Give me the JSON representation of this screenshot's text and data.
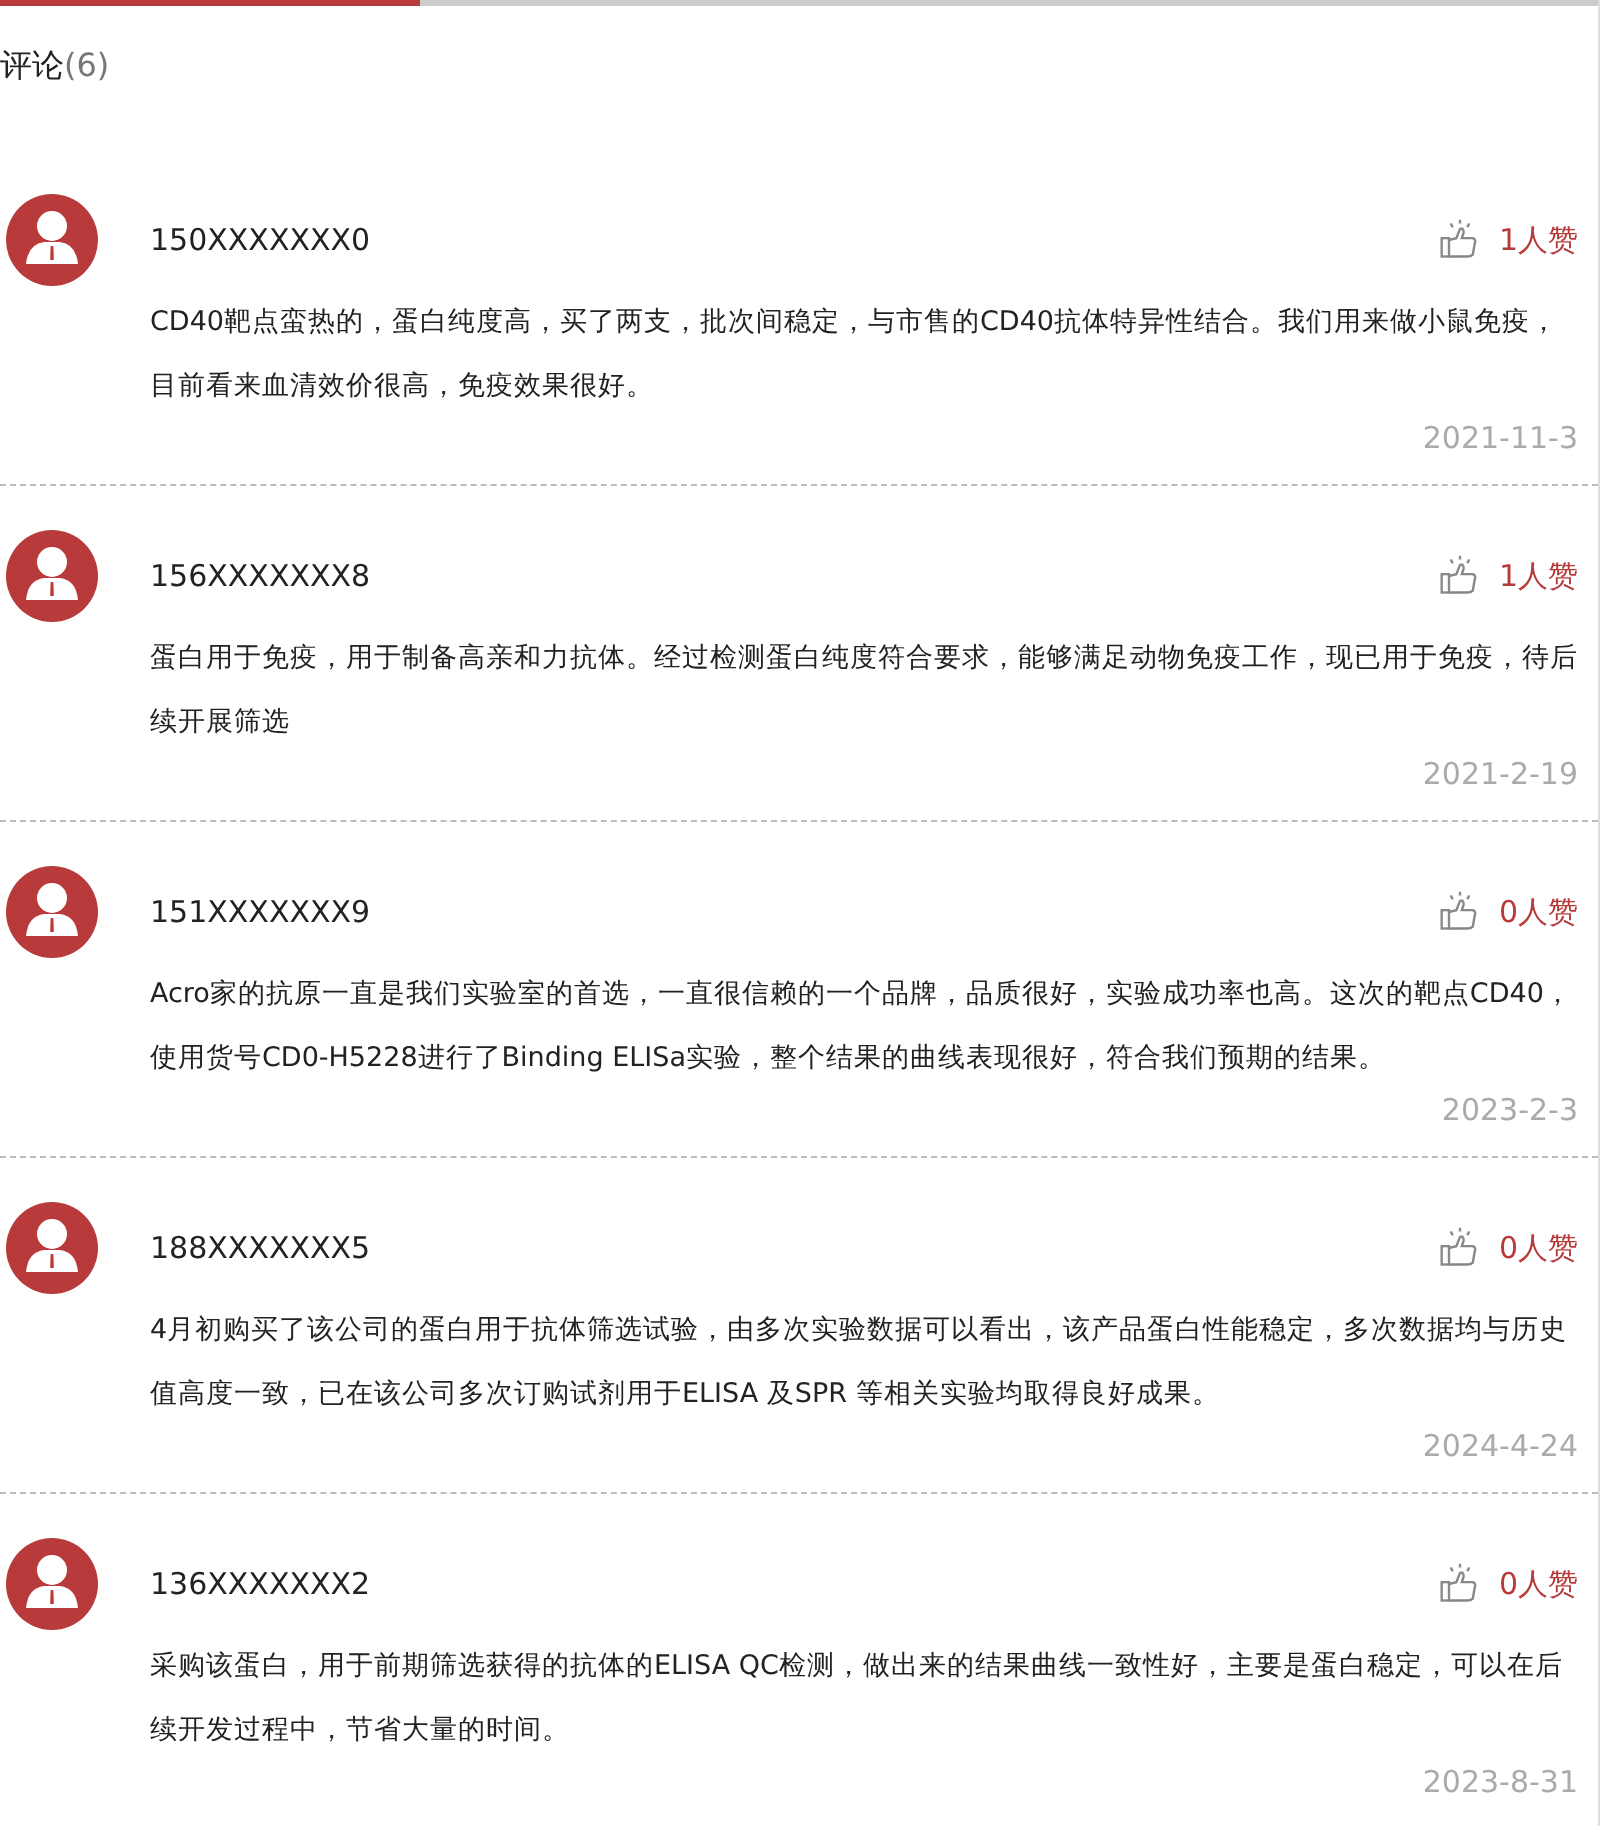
{
  "heading": {
    "label": "评论",
    "count": "(6)"
  },
  "comments": [
    {
      "user": "150XXXXXXX0",
      "likes": "1人赞",
      "text": "CD40靶点蛮热的，蛋白纯度高，买了两支，批次间稳定，与市售的CD40抗体特异性结合。我们用来做小鼠免疫，目前看来血清效价很高，免疫效果很好。",
      "date": "2021-11-3"
    },
    {
      "user": "156XXXXXXX8",
      "likes": "1人赞",
      "text": "蛋白用于免疫，用于制备高亲和力抗体。经过检测蛋白纯度符合要求，能够满足动物免疫工作，现已用于免疫，待后续开展筛选",
      "date": "2021-2-19"
    },
    {
      "user": "151XXXXXXX9",
      "likes": "0人赞",
      "text": "Acro家的抗原一直是我们实验室的首选，一直很信赖的一个品牌，品质很好，实验成功率也高。这次的靶点CD40，使用货号CD0-H5228进行了Binding ELISa实验，整个结果的曲线表现很好，符合我们预期的结果。",
      "date": "2023-2-3"
    },
    {
      "user": "188XXXXXXX5",
      "likes": "0人赞",
      "text": "4月初购买了该公司的蛋白用于抗体筛选试验，由多次实验数据可以看出，该产品蛋白性能稳定，多次数据均与历史值高度一致，已在该公司多次订购试剂用于ELISA 及SPR 等相关实验均取得良好成果。",
      "date": "2024-4-24"
    },
    {
      "user": "136XXXXXXX2",
      "likes": "0人赞",
      "text": "采购该蛋白，用于前期筛选获得的抗体的ELISA QC检测，做出来的结果曲线一致性好，主要是蛋白稳定，可以在后续开发过程中，节省大量的时间。",
      "date": "2023-8-31"
    }
  ]
}
